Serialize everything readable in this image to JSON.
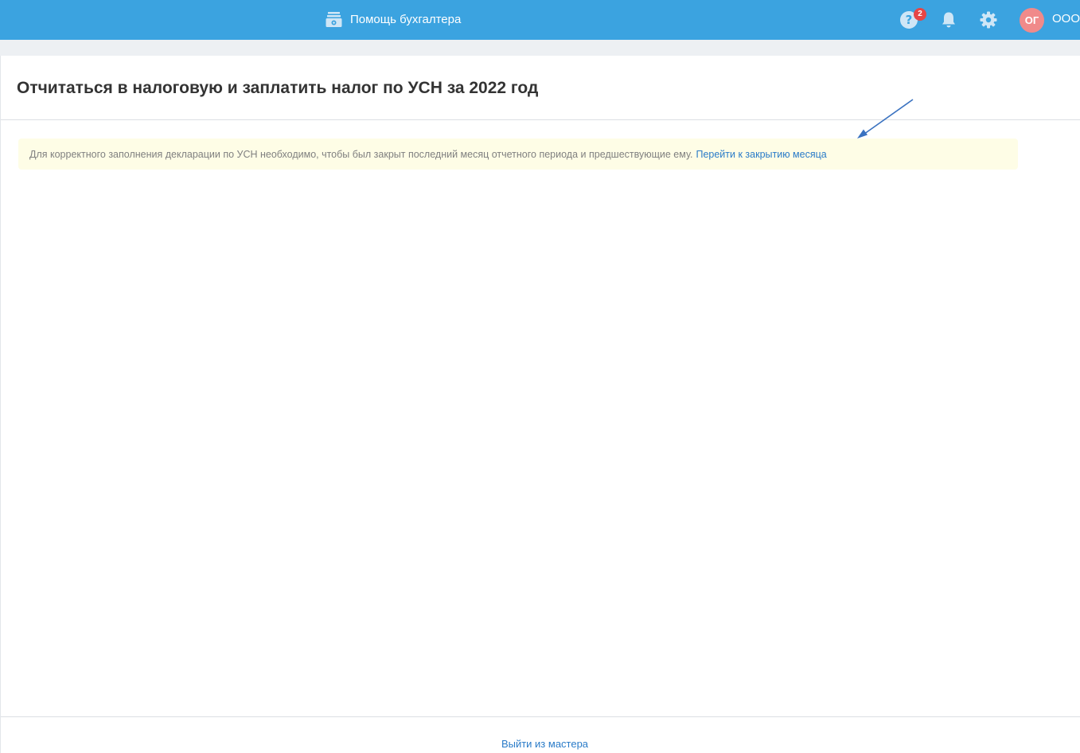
{
  "topbar": {
    "help_accountant_label": "Помощь бухгалтера",
    "help_badge_count": "2",
    "user_initials": "ОГ",
    "org_name": "ООО",
    "icons": {
      "help_accountant": "cash-register-icon",
      "help": "question-circle-icon",
      "notifications": "bell-icon",
      "settings": "gear-icon"
    }
  },
  "main": {
    "title": "Отчитаться в налоговую и заплатить налог по УСН за 2022 год",
    "notice_text": "Для корректного заполнения декларации по УСН необходимо, чтобы был закрыт последний месяц отчетного периода и предшествующие ему.",
    "notice_link": "Перейти к закрытию месяца"
  },
  "footer": {
    "exit_wizard_label": "Выйти из мастера"
  },
  "colors": {
    "topbar_bg": "#3ba3e0",
    "badge_bg": "#e64646",
    "avatar_bg": "#f08a8a",
    "link": "#2a7bc8",
    "notice_bg": "#fefde6",
    "annotation_arrow": "#3a72c0"
  }
}
